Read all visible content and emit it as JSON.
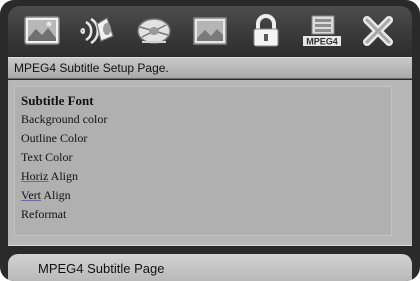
{
  "toolbar": {
    "icons": [
      {
        "name": "general-setup-icon"
      },
      {
        "name": "audio-setup-icon"
      },
      {
        "name": "video-setup-icon"
      },
      {
        "name": "preference-setup-icon"
      },
      {
        "name": "password-lock-icon"
      },
      {
        "name": "mpeg4-subtitle-icon",
        "label": "MPEG4"
      },
      {
        "name": "exit-icon"
      }
    ]
  },
  "page": {
    "title": "MPEG4 Subtitle Setup Page.",
    "footer": "MPEG4 Subtitle Page"
  },
  "menu": {
    "header": "Subtitle Font",
    "items": [
      {
        "label": "Background color"
      },
      {
        "label": "Outline Color"
      },
      {
        "label": "Text Color"
      },
      {
        "prefix": "Horiz",
        "rest": " Align"
      },
      {
        "prefix": "Vert",
        "rest": " Align"
      },
      {
        "label": "Reformat"
      }
    ]
  }
}
